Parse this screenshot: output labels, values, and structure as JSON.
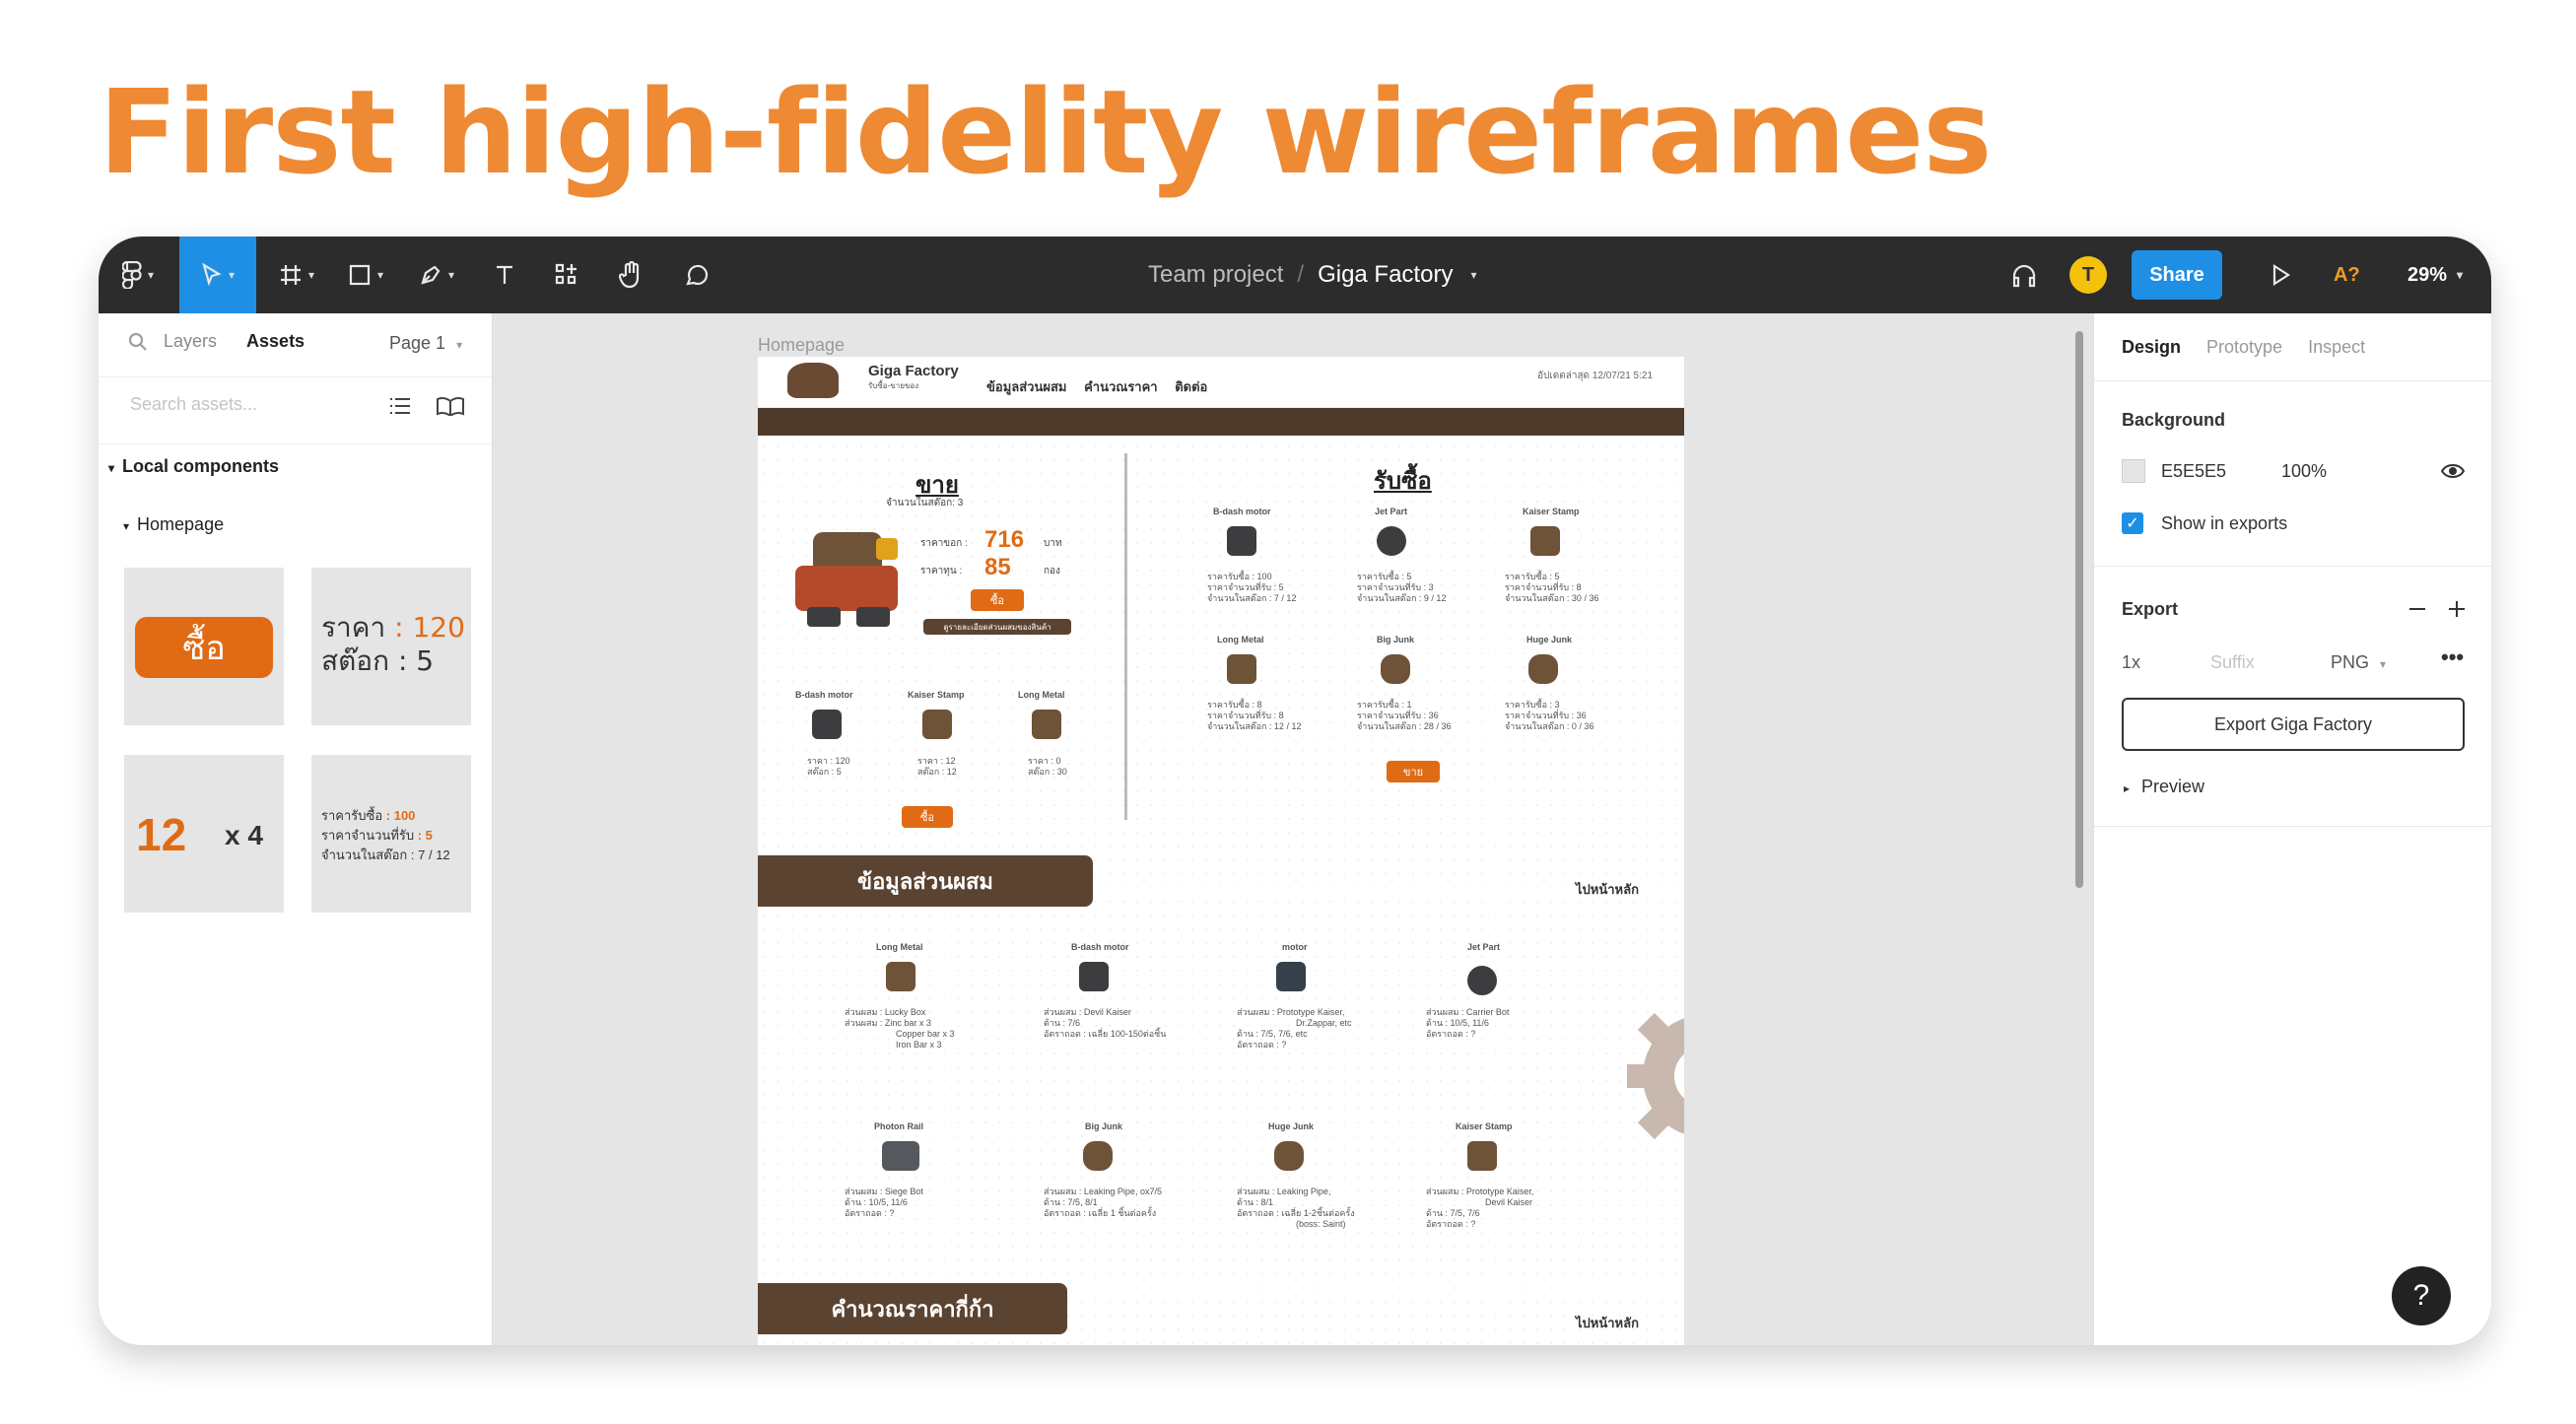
{
  "headline": "First high-fidelity wireframes",
  "toolbar": {
    "project": "Team project",
    "separator": "/",
    "file": "Giga Factory",
    "avatar_initial": "T",
    "share_label": "Share",
    "ai_label": "A?",
    "zoom": "29%"
  },
  "left_panel": {
    "tab_layers": "Layers",
    "tab_assets": "Assets",
    "page_selector": "Page 1",
    "search_placeholder": "Search assets...",
    "section_local": "Local components",
    "section_homepage": "Homepage",
    "comp_buy_label": "ซื้อ",
    "comp_price_label": "ราคา",
    "comp_price_value": ": 120",
    "comp_stock_label": "สต๊อก",
    "comp_stock_value": ": 5",
    "comp_count": "12",
    "comp_multiplier": "x 4",
    "comp_list_row1_label": "ราคารับซื้อ",
    "comp_list_row1_value": ": 100",
    "comp_list_row2_label": "ราคาจำนวนที่รับ",
    "comp_list_row2_value": ": 5",
    "comp_list_row3_label": "จำนวนในสต๊อก",
    "comp_list_row3_value": ": 7 / 12"
  },
  "canvas": {
    "frame_label": "Homepage",
    "brand": "Giga Factory",
    "brand_sub": "รับซื้อ-ขายของ",
    "nav_links": "ข้อมูลส่วนผสม คำนวณราคา ติดต่อ",
    "date_text": "อัปเดตล่าสุด 12/07/21 5:21",
    "sell": {
      "title": "ขาย",
      "stock_label": "จำนวนในสต๊อก: 3",
      "sell_price_label": "ราคาขอก :",
      "sell_price_value": "716",
      "sell_price_unit": "บาท",
      "buy_price_label": "ราคาทุน :",
      "buy_price_value": "85",
      "buy_price_unit": "กอง",
      "button_label": "ซื้อ",
      "note_button": "ดูรายละเอียดส่วนผสมของสินค้า",
      "items": [
        {
          "name": "B-dash motor",
          "l1": "ราคา : 120",
          "l2": "สต๊อก : 5"
        },
        {
          "name": "Kaiser Stamp",
          "l1": "ราคา : 12",
          "l2": "สต๊อก : 12"
        },
        {
          "name": "Long Metal",
          "l1": "ราคา : 0",
          "l2": "สต๊อก : 30"
        }
      ],
      "bottom_button": "ซื้อ"
    },
    "buy": {
      "title": "รับซื้อ",
      "items": [
        {
          "name": "B-dash motor",
          "l1": "ราคารับซื้อ : 100",
          "l2": "ราคาจำนวนที่รับ : 5",
          "l3": "จำนวนในสต๊อก : 7 / 12"
        },
        {
          "name": "Jet Part",
          "l1": "ราคารับซื้อ : 5",
          "l2": "ราคาจำนวนที่รับ : 3",
          "l3": "จำนวนในสต๊อก : 9 / 12"
        },
        {
          "name": "Kaiser Stamp",
          "l1": "ราคารับซื้อ : 5",
          "l2": "ราคาจำนวนที่รับ : 8",
          "l3": "จำนวนในสต๊อก : 30 / 36"
        },
        {
          "name": "Long Metal",
          "l1": "ราคารับซื้อ : 8",
          "l2": "ราคาจำนวนที่รับ : 8",
          "l3": "จำนวนในสต๊อก : 12 / 12"
        },
        {
          "name": "Big Junk",
          "l1": "ราคารับซื้อ : 1",
          "l2": "ราคาจำนวนที่รับ : 36",
          "l3": "จำนวนในสต๊อก : 28 / 36"
        },
        {
          "name": "Huge Junk",
          "l1": "ราคารับซื้อ : 3",
          "l2": "ราคาจำนวนที่รับ : 36",
          "l3": "จำนวนในสต๊อก : 0 / 36"
        }
      ],
      "button_label": "ขาย"
    },
    "ingredients": {
      "banner": "ข้อมูลส่วนผสม",
      "go_home": "ไปหน้าหลัก",
      "items": [
        {
          "name": "Long Metal",
          "l1": "ส่วนผสม : Lucky Box",
          "l2": "ส่วนผสม : Zinc bar x 3",
          "l3": "Copper bar x 3",
          "l4": "Iron Bar x 3"
        },
        {
          "name": "B-dash motor",
          "l1": "ส่วนผสม : Devil Kaiser",
          "l2": "ด้าน : 7/6",
          "l3": "อัตราถอด : เฉลี่ย 100-150ต่อชิ้น"
        },
        {
          "name": "motor",
          "l1": "ส่วนผสม : Prototype Kaiser,",
          "l2": "Dr.Zappar, etc",
          "l3": "ด้าน : 7/5, 7/6, etc",
          "l4": "อัตราถอด : ?"
        },
        {
          "name": "Jet Part",
          "l1": "ส่วนผสม : Carrier Bot",
          "l2": "ด้าน : 10/5, 11/6",
          "l3": "อัตราถอด : ?"
        },
        {
          "name": "Photon Rail",
          "l1": "ส่วนผสม : Siege Bot",
          "l2": "ด้าน : 10/5, 11/6",
          "l3": "อัตราถอด : ?"
        },
        {
          "name": "Big Junk",
          "l1": "ส่วนผสม : Leaking Pipe, ox7/5",
          "l2": "ด้าน : 7/5, 8/1",
          "l3": "อัตราถอด : เฉลี่ย 1 ชิ้นต่อครั้ง"
        },
        {
          "name": "Huge Junk",
          "l1": "ส่วนผสม : Leaking Pipe,",
          "l2": "ด้าน : 8/1",
          "l3": "อัตราถอด : เฉลี่ย 1-2ชิ้นต่อครั้ง",
          "l4": "(boss: Saint)"
        },
        {
          "name": "Kaiser Stamp",
          "l1": "ส่วนผสม : Prototype Kaiser,",
          "l2": "Devil Kaiser",
          "l3": "ด้าน : 7/5, 7/6",
          "l4": "อัตราถอด : ?"
        }
      ]
    },
    "calc": {
      "banner": "คำนวณราคากี่ก้า",
      "go_home": "ไปหน้าหลัก"
    }
  },
  "right_panel": {
    "tabs": [
      "Design",
      "Prototype",
      "Inspect"
    ],
    "background_title": "Background",
    "bg_color": "E5E5E5",
    "bg_opacity": "100%",
    "show_in_exports": "Show in exports",
    "export_title": "Export",
    "export_scale": "1x",
    "export_suffix_placeholder": "Suffix",
    "export_format": "PNG",
    "export_button": "Export Giga Factory",
    "preview": "Preview"
  },
  "colors": {
    "headline": "#ee8a33",
    "toolbar": "#2c2c2c",
    "accent_blue": "#1f8fe6",
    "wire_orange": "#e06b14",
    "wire_brown": "#5b4331"
  }
}
